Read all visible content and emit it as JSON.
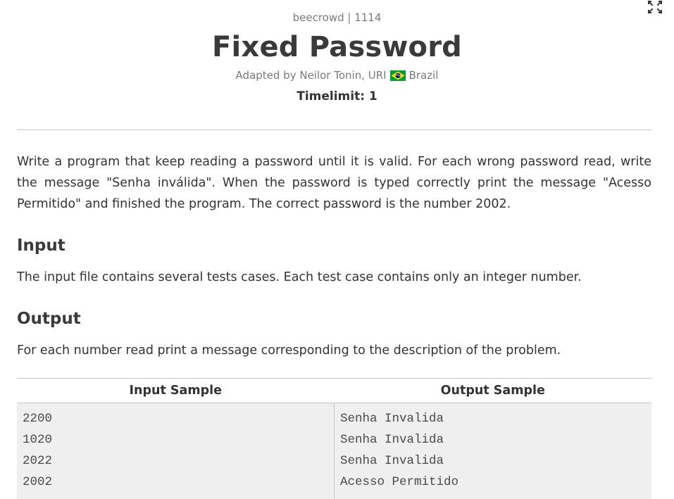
{
  "header": {
    "site": "beecrowd | 1114",
    "title": "Fixed Password",
    "adapted_by": "Adapted by Neilor Tonin, URI",
    "country": "Brazil",
    "timelimit": "Timelimit: 1"
  },
  "icons": {
    "expand": "expand-icon",
    "flag": "brazil-flag-icon"
  },
  "colors": {
    "flag_green": "#009c3b",
    "flag_yellow": "#ffdf00",
    "flag_blue": "#002776"
  },
  "description": "Write a program that keep reading a password until it is valid. For each wrong password read, write the message \"Senha inválida\". When the password is typed correctly print the message \"Acesso Permitido\" and finished the program. The correct password is the number 2002.",
  "input": {
    "title": "Input",
    "text": "The input file contains several tests cases. Each test case contains only an integer number."
  },
  "output": {
    "title": "Output",
    "text": "For each number read print a message corresponding to the description of the problem."
  },
  "samples": {
    "input_header": "Input Sample",
    "output_header": "Output Sample",
    "input_lines": [
      "2200",
      "1020",
      "2022",
      "2002"
    ],
    "output_lines": [
      "Senha Invalida",
      "Senha Invalida",
      "Senha Invalida",
      "Acesso Permitido"
    ]
  }
}
